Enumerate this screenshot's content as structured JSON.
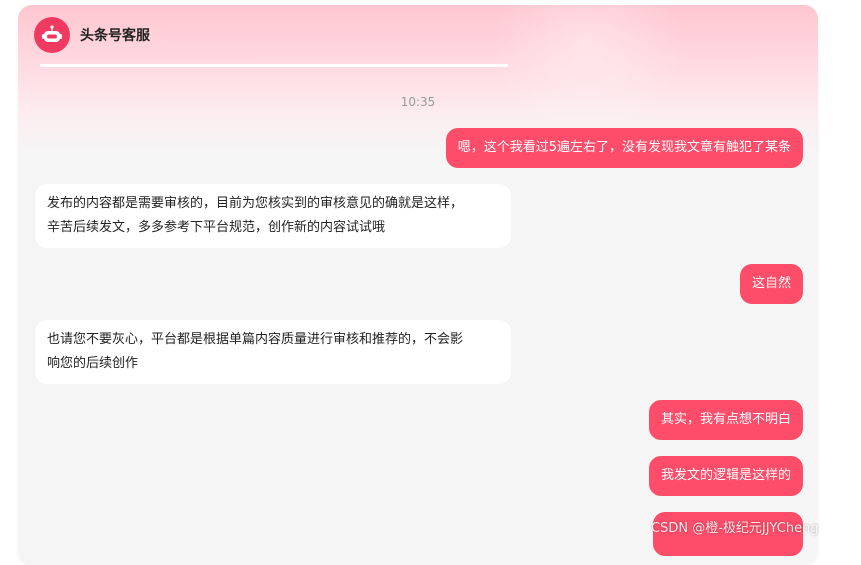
{
  "header": {
    "title": "头条号客服",
    "avatar_icon": "robot-icon",
    "progress": 1.0
  },
  "chat": {
    "timestamp": "10:35",
    "messages": [
      {
        "side": "right",
        "text": "嗯，这个我看过5遍左右了，没有发现我文章有触犯了某条"
      },
      {
        "side": "left",
        "lines": [
          "发布的内容都是需要审核的，目前为您核实到的审核意见的确就是这样，",
          "辛苦后续发文，多多参考下平台规范，创作新的内容试试哦"
        ]
      },
      {
        "side": "right",
        "text": "这自然"
      },
      {
        "side": "left",
        "lines": [
          "也请您不要灰心，平台都是根据单篇内容质量进行审核和推荐的，不会影",
          "响您的后续创作"
        ]
      },
      {
        "side": "right",
        "text": "其实，我有点想不明白"
      },
      {
        "side": "right",
        "text": "我发文的逻辑是这样的"
      },
      {
        "side": "right",
        "text": ""
      }
    ]
  },
  "colors": {
    "accent": "#fe4d6a",
    "avatar": "#f03a5f"
  },
  "watermark": "CSDN @橙-极纪元JJYCheng"
}
